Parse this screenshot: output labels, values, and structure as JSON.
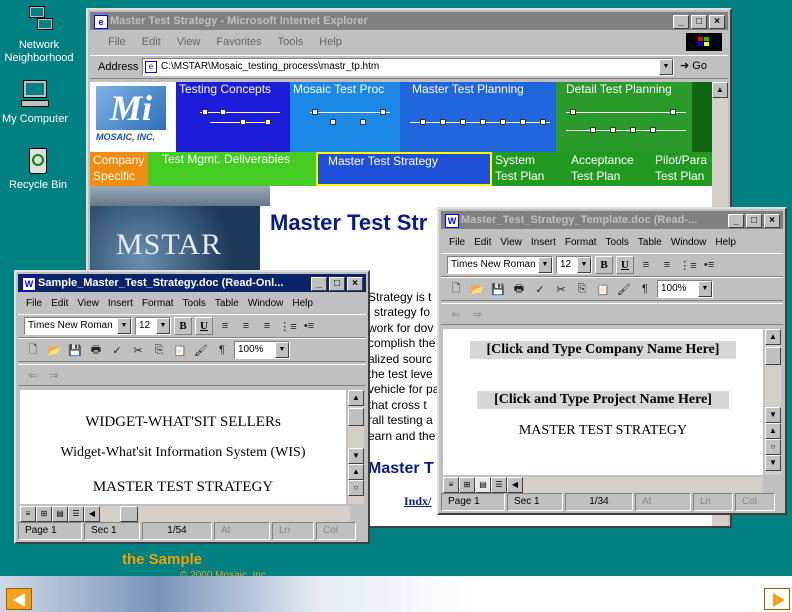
{
  "desktop": {
    "icons": [
      {
        "label": "Network Neighborhood",
        "icon": "network-neighborhood-icon"
      },
      {
        "label": "My Computer",
        "icon": "my-computer-icon"
      },
      {
        "label": "Recycle Bin",
        "icon": "recycle-bin-icon"
      }
    ]
  },
  "ie": {
    "title": "Master Test Strategy - Microsoft Internet Explorer",
    "menu": [
      "File",
      "Edit",
      "View",
      "Favorites",
      "Tools",
      "Help"
    ],
    "address_label": "Address",
    "address_value": "C:\\MSTAR\\Mosaic_testing_process\\mastr_tp.htm",
    "go_label": "Go",
    "logo_text": "MOSAIC, INC.",
    "nav_top": [
      "Testing Concepts",
      "Mosaic Test Proc",
      "Master Test Planning",
      "Detail Test Planning"
    ],
    "nav_bottom": [
      "Company Specific",
      "Test Mgmt. Deliverables",
      "Master Test Strategy",
      "System Test Plan",
      "Acceptance Test Plan",
      "Pilot/Para Test Plan"
    ],
    "banner_text": "MSTAR",
    "page_heading": "Master Test Str",
    "body_lines": [
      "Strategy is t",
      "l strategy fo",
      "work for dov",
      "complish the",
      "alized sourc",
      "the test leve",
      "vehicle for pa",
      "that cross t",
      "rall testing a",
      "earn and the"
    ],
    "sub_heading": "Master T",
    "link_text": "Indx/"
  },
  "word_left": {
    "title": "Sample_Master_Test_Strategy.doc (Read-Onl...",
    "menu": [
      "File",
      "Edit",
      "View",
      "Insert",
      "Format",
      "Tools",
      "Table",
      "Window",
      "Help"
    ],
    "font": "Times New Roman",
    "size": "12",
    "zoom": "100%",
    "doc_lines": [
      "WIDGET-WHAT'SIT SELLERs",
      "Widget-What'sit Information System (WIS)",
      "MASTER TEST STRATEGY"
    ],
    "status": [
      "Page  1",
      "Sec  1",
      "1/54",
      "At",
      "Ln",
      "Col"
    ]
  },
  "word_right": {
    "title": "Master_Test_Strategy_Template.doc (Read-...",
    "menu": [
      "File",
      "Edit",
      "View",
      "Insert",
      "Format",
      "Tools",
      "Table",
      "Window",
      "Help"
    ],
    "font": "Times New Roman",
    "size": "12",
    "zoom": "100%",
    "doc_lines": [
      "[Click and Type Company Name Here]",
      "[Click and Type Project Name Here]",
      "MASTER TEST STRATEGY"
    ],
    "status": [
      "Page  1",
      "Sec  1",
      "1/34",
      "At",
      "Ln",
      "Col"
    ]
  },
  "footer": {
    "caption": "the Sample",
    "copyright": "© 2000 Mosaic, Inc."
  }
}
